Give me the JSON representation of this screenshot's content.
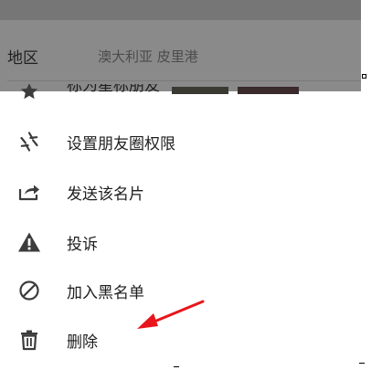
{
  "header": {
    "region_label": "地区",
    "region_value": "澳大利亚  皮里港"
  },
  "menu": {
    "items": [
      {
        "label": "标为星标朋友",
        "icon": "star-icon"
      },
      {
        "label": "设置朋友圈权限",
        "icon": "aperture-icon"
      },
      {
        "label": "发送该名片",
        "icon": "share-icon"
      },
      {
        "label": "投诉",
        "icon": "warning-icon"
      },
      {
        "label": "加入黑名单",
        "icon": "block-icon"
      },
      {
        "label": "删除",
        "icon": "trash-icon"
      }
    ]
  },
  "colors": {
    "icon": "#3c3c3c",
    "text": "#1e1e1e",
    "annotation_arrow": "#e8161c",
    "dim_overlay": "#8a8a8a"
  }
}
